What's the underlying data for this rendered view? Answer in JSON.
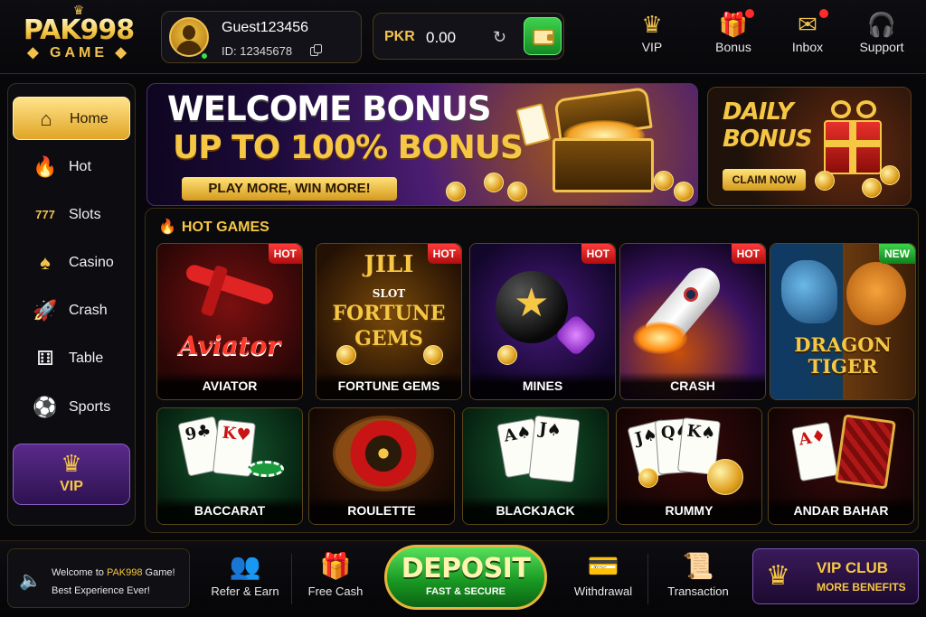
{
  "logo": {
    "brand": "PAK998",
    "sub": "GAME"
  },
  "user": {
    "name": "Guest123456",
    "id_text": "ID: 12345678"
  },
  "wallet": {
    "currency": "PKR",
    "balance": "0.00"
  },
  "nav": [
    {
      "label": "VIP",
      "icon": "crown-icon",
      "dot": false
    },
    {
      "label": "Bonus",
      "icon": "gift-icon",
      "dot": true
    },
    {
      "label": "Inbox",
      "icon": "envelope-icon",
      "dot": true
    },
    {
      "label": "Support",
      "icon": "headset-icon",
      "dot": false
    }
  ],
  "sidebar": {
    "items": [
      {
        "label": "Home",
        "icon": "home-icon",
        "active": true
      },
      {
        "label": "Hot",
        "icon": "fire-icon",
        "active": false
      },
      {
        "label": "Slots",
        "icon": "slot-machine-icon",
        "active": false
      },
      {
        "label": "Casino",
        "icon": "spade-icon",
        "active": false
      },
      {
        "label": "Crash",
        "icon": "rocket-icon",
        "active": false
      },
      {
        "label": "Table",
        "icon": "dice-icon",
        "active": false
      },
      {
        "label": "Sports",
        "icon": "soccer-ball-icon",
        "active": false
      }
    ],
    "vip_label": "VIP"
  },
  "banner_main": {
    "title": "WELCOME BONUS",
    "subtitle": "UP TO 100% BONUS",
    "cta": "PLAY MORE, WIN MORE!"
  },
  "banner_daily": {
    "line1": "DAILY",
    "line2": "BONUS",
    "cta": "CLAIM NOW"
  },
  "hot_games": {
    "title": "HOT GAMES",
    "row1": [
      {
        "label": "AVIATOR",
        "badge": "HOT",
        "art_text": "Aviator"
      },
      {
        "label": "FORTUNE GEMS",
        "badge": "HOT",
        "art_text": "JILI"
      },
      {
        "label": "MINES",
        "badge": "HOT"
      },
      {
        "label": "CRASH",
        "badge": "HOT"
      },
      {
        "label": "",
        "badge": "NEW",
        "art_text": "DRAGON TIGER"
      }
    ],
    "row2": [
      {
        "label": "BACCARAT"
      },
      {
        "label": "ROULETTE"
      },
      {
        "label": "BLACKJACK"
      },
      {
        "label": "RUMMY"
      },
      {
        "label": "ANDAR BAHAR"
      }
    ],
    "fortune_gems_art": {
      "small": "SLOT",
      "big1": "FORTUNE",
      "big2": "GEMS"
    }
  },
  "bottom": {
    "notice_line1_pre": "Welcome to ",
    "notice_brand": "PAK998",
    "notice_line1_post": " Game!",
    "notice_line2": "Best Experience Ever!",
    "refer": "Refer & Earn",
    "freecash": "Free Cash",
    "deposit_title": "DEPOSIT",
    "deposit_sub": "FAST & SECURE",
    "withdrawal": "Withdrawal",
    "transaction": "Transaction",
    "vipclub_title": "VIP CLUB",
    "vipclub_sub": "MORE BENEFITS"
  },
  "colors": {
    "gold": "#f6c744",
    "hot_badge": "#e02020",
    "new_badge": "#2cb63a",
    "deposit_green": "#1a9a23",
    "vip_purple": "#3a1a5a"
  }
}
